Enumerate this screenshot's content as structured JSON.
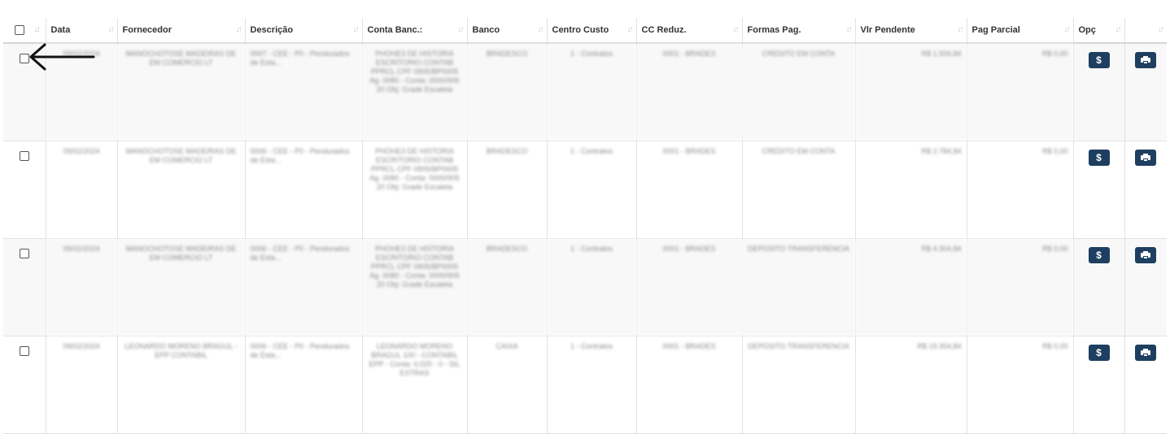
{
  "table": {
    "headers": [
      {
        "key": "select",
        "label": ""
      },
      {
        "key": "data",
        "label": "Data"
      },
      {
        "key": "fornecedor",
        "label": "Fornecedor"
      },
      {
        "key": "descricao",
        "label": "Descrição"
      },
      {
        "key": "conta",
        "label": "Conta Banc.:"
      },
      {
        "key": "banco",
        "label": "Banco"
      },
      {
        "key": "centro",
        "label": "Centro Custo"
      },
      {
        "key": "ccreduz",
        "label": "CC Reduz."
      },
      {
        "key": "formas",
        "label": "Formas Pag."
      },
      {
        "key": "vlr",
        "label": "Vlr Pendente"
      },
      {
        "key": "parcial",
        "label": "Pag Parcial"
      },
      {
        "key": "opc",
        "label": "Opç"
      },
      {
        "key": "print",
        "label": ""
      }
    ],
    "sort_glyph": "↓↑",
    "sort_glyph_first": "↓↕",
    "pay_button_label": "$",
    "rows": [
      {
        "data": "09/02/2024",
        "fornecedor": "MANOCHOTOSE MADEIRAS DE EM COMERCIO LT",
        "descricao": "0007 - CEE - P0 - Pendurados de Esta...",
        "conta": "PHOHE3 DE HISTORIA ESCRITORIO CONTAB PPRCL CPF 0905/BP0005 Ag. 0080 - Conta: 0000/905 20 Obj: Grade Escaleta",
        "banco": "BRADESCO",
        "centro": "1 - Contratos",
        "ccreduz": "0001 - BRADES",
        "formas": "CREDITO EM CONTA",
        "vlr": "R$ 1.934,84",
        "parcial": "R$ 0,00"
      },
      {
        "data": "09/02/2024",
        "fornecedor": "MANOCHOTOSE MADEIRAS DE EM COMERCIO LT",
        "descricao": "0006 - CEE - P0 - Pendurados de Esta...",
        "conta": "PHOHE3 DE HISTORIA ESCRITORIO CONTAB PPRCL CPF 0905/BP0005 Ag. 0080 - Conta: 0000/905 20 Obj: Grade Escaleta",
        "banco": "BRADESCO",
        "centro": "1 - Contratos",
        "ccreduz": "0001 - BRADES",
        "formas": "CREDITO EM CONTA",
        "vlr": "R$ 2.784,84",
        "parcial": "R$ 0,00"
      },
      {
        "data": "09/02/2024",
        "fornecedor": "MANOCHOTOSE MADEIRAS DE EM COMERCIO LT",
        "descricao": "0006 - CEE - P0 - Pendurados de Esta...",
        "conta": "PHOHE3 DE HISTORIA ESCRITORIO CONTAB PPRCL CPF 0905/BP0005 Ag. 0080 - Conta: 0000/905 20 Obj: Grade Escaleta",
        "banco": "BRADESCO",
        "centro": "1 - Contratos",
        "ccreduz": "0001 - BRADES",
        "formas": "DEPOSITO TRANSFERENCIA",
        "vlr": "R$ 4.304,84",
        "parcial": "R$ 0,00"
      },
      {
        "data": "09/02/2024",
        "fornecedor": "LEONARDO MORENO BRAGUL - EPP CONTABIL",
        "descricao": "0006 - CEE - P0 - Pendurados de Esta...",
        "conta": "LEONARDO MORENO BRAGUL 100 - CONTABIL EPP - Conta: 0,025 - 0 - SIL EXTRAS",
        "banco": "CAIXA",
        "centro": "1 - Contratos",
        "ccreduz": "0001 - BRADES",
        "formas": "DEPOSITO TRANSFERENCIA",
        "vlr": "R$ 19.304,84",
        "parcial": "R$ 0,00"
      }
    ]
  }
}
